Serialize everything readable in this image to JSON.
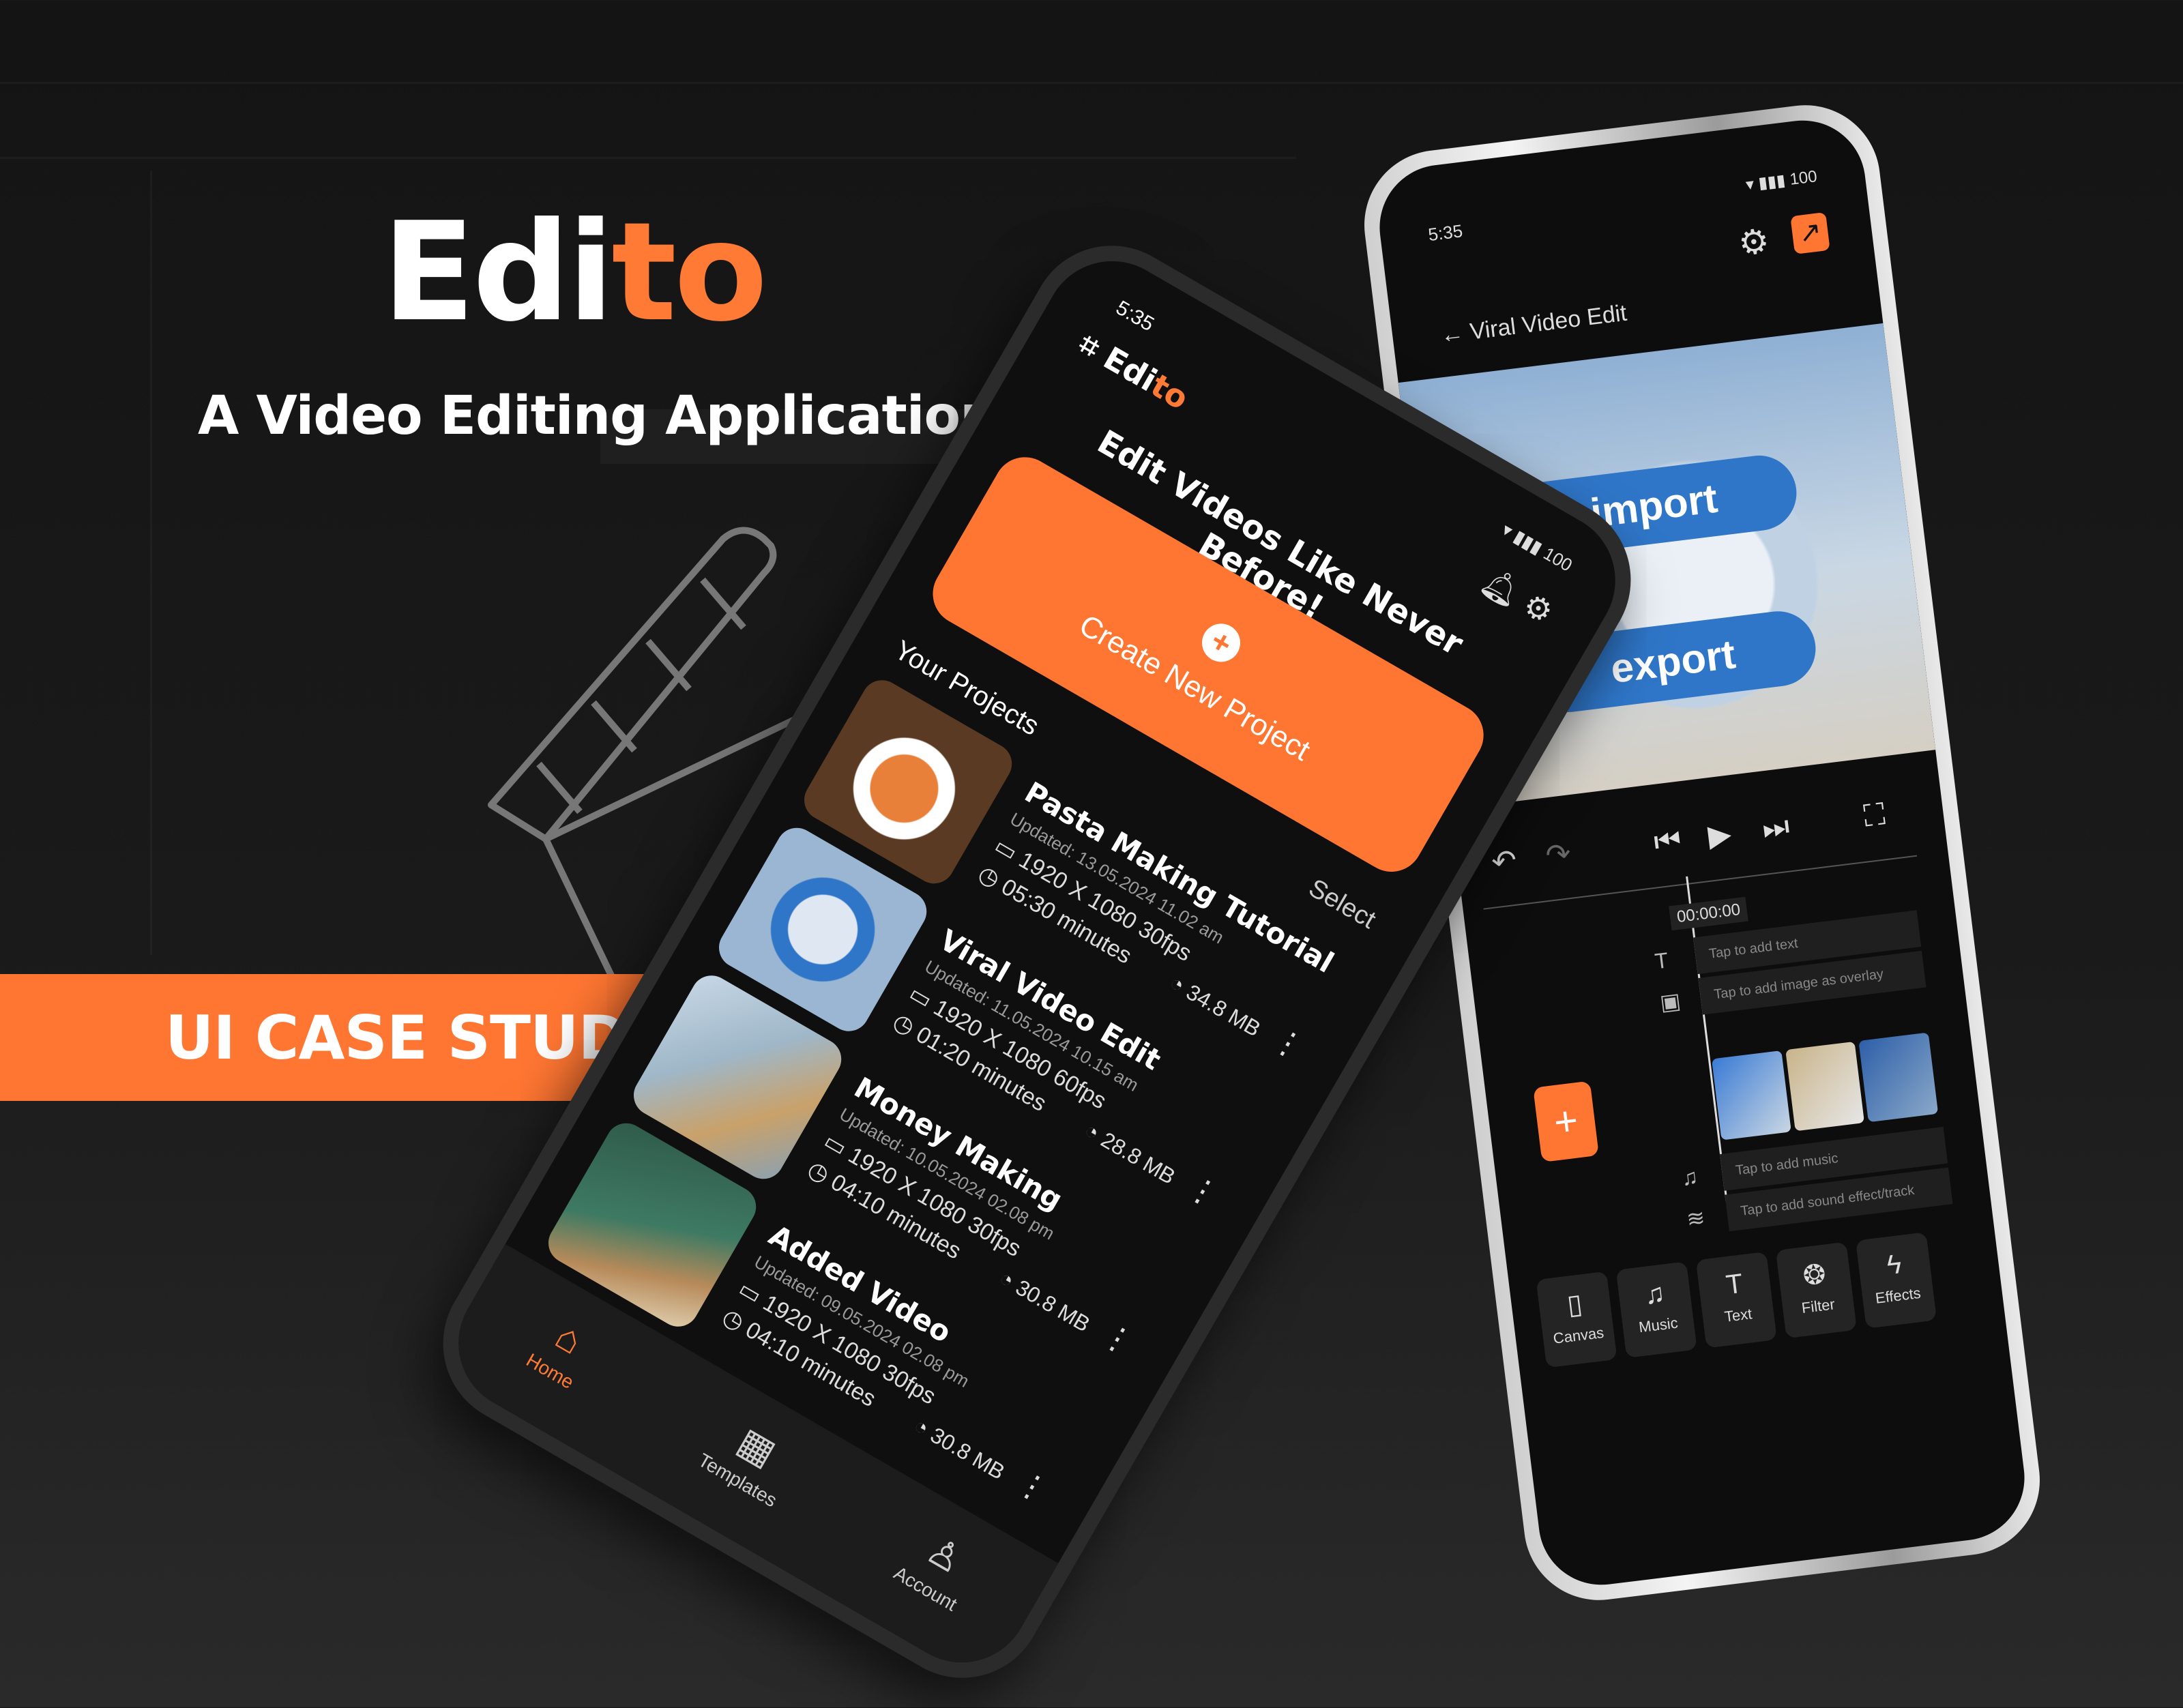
{
  "hero": {
    "brand_main": "Edi",
    "brand_accent": "to",
    "tagline": "A Video Editing Application",
    "banner": "UI CASE STUDY"
  },
  "colors": {
    "accent": "#ff7632",
    "background": "#141414"
  },
  "home_screen": {
    "time": "5:35",
    "status": "▾ ▮▮▮ 100",
    "logo_main": "Edi",
    "logo_accent": "to",
    "headline": "Edit Videos Like Never Before!",
    "create_button": "Create New Project",
    "section_title": "Your Projects",
    "select_label": "Select",
    "projects": [
      {
        "title": "Pasta Making Tutorial",
        "updated": "Updated: 13.05.2024 11.02 am",
        "resolution": "1920 X 1080 30fps",
        "duration": "05:30 minutes",
        "size": "34.8 MB"
      },
      {
        "title": "Viral Video Edit",
        "updated": "Updated: 11.05.2024 10.15 am",
        "resolution": "1920 X 1080 60fps",
        "duration": "01:20 minutes",
        "size": "28.8 MB"
      },
      {
        "title": "Money Making",
        "updated": "Updated: 10.05.2024 02.08 pm",
        "resolution": "1920 X 1080 30fps",
        "duration": "04:10 minutes",
        "size": "30.8 MB"
      },
      {
        "title": "Added Video",
        "updated": "Updated: 09.05.2024 02.08 pm",
        "resolution": "1920 X 1080 30fps",
        "duration": "04:10 minutes",
        "size": "30.8 MB"
      }
    ],
    "nav": {
      "home": "Home",
      "templates": "Templates",
      "account": "Account"
    }
  },
  "editor_screen": {
    "time": "5:35",
    "status": "▾ ▮▮▮ 100",
    "title": "Viral Video Edit",
    "video_word_top": "import",
    "video_word_bottom": "export",
    "timecode": "00:00:00",
    "tracks": {
      "text": "Tap to add text",
      "image": "Tap to add image as overlay",
      "music": "Tap to add music",
      "sound": "Tap to add sound effect/track"
    },
    "tools": [
      "Canvas",
      "Music",
      "Text",
      "Filter",
      "Effects"
    ]
  }
}
